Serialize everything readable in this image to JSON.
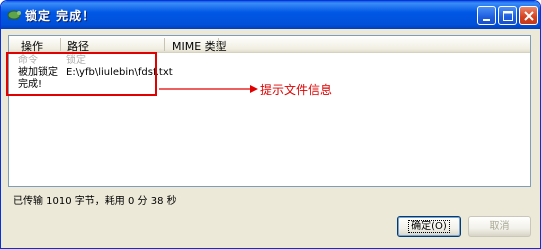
{
  "window": {
    "title": "锁定 完成！"
  },
  "list": {
    "headers": {
      "operation": "操作",
      "path": "路径",
      "mime": "MIME 类型"
    },
    "rows": [
      {
        "operation": "命令",
        "path": "锁定",
        "faint": true
      },
      {
        "operation": "被加锁定",
        "path": "E:\\yfb\\liulebin\\fdsf.txt",
        "faint": false
      },
      {
        "operation": "完成!",
        "path": "",
        "faint": false
      }
    ]
  },
  "annotation": {
    "text": "提示文件信息",
    "color": "#e00000"
  },
  "status": {
    "text": "已传输 1010 字节，耗用 0 分 38 秒"
  },
  "buttons": {
    "ok": "确定(O)",
    "cancel": "取消"
  }
}
